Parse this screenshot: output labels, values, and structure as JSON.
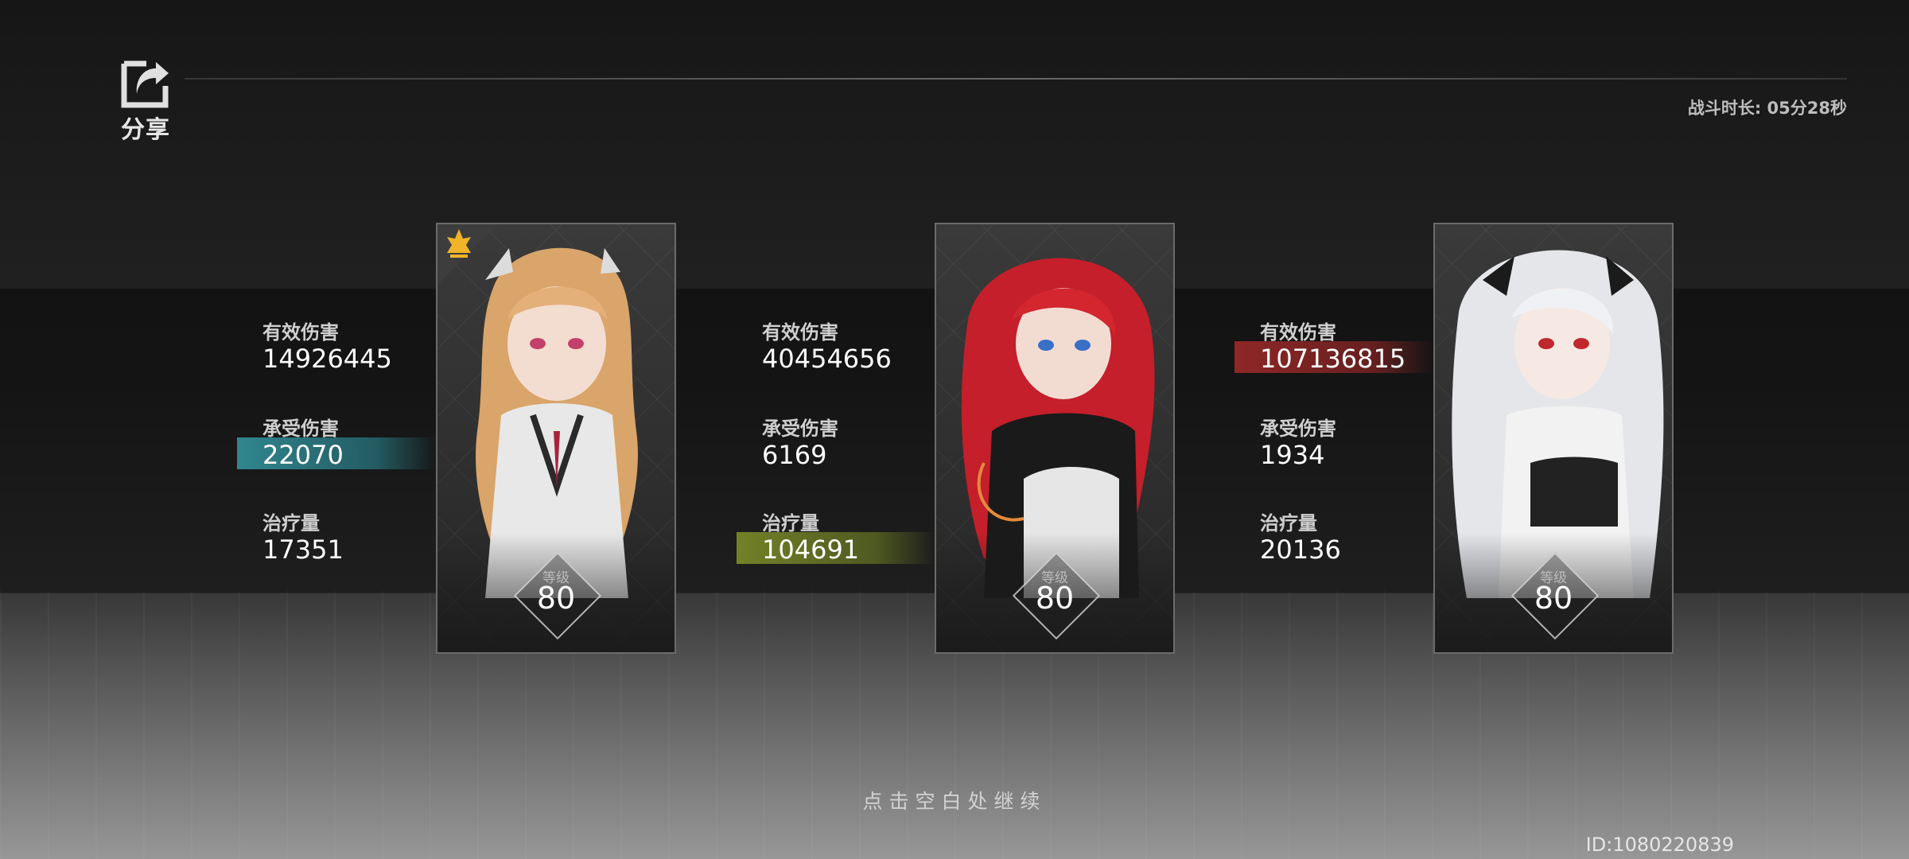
{
  "header": {
    "share_label": "分享",
    "duration_text": "战斗时长: 05分28秒"
  },
  "labels": {
    "damage": "有效伤害",
    "taken": "承受伤害",
    "heal": "治疗量",
    "level": "等级"
  },
  "characters": [
    {
      "name": "blonde-heroine",
      "damage": "14926445",
      "taken": "22070",
      "heal": "17351",
      "level": "80",
      "mvp": true,
      "highlight": "taken"
    },
    {
      "name": "red-heroine",
      "damage": "40454656",
      "taken": "6169",
      "heal": "104691",
      "level": "80",
      "mvp": false,
      "highlight": "heal"
    },
    {
      "name": "white-heroine",
      "damage": "107136815",
      "taken": "1934",
      "heal": "20136",
      "level": "80",
      "mvp": false,
      "highlight": "damage"
    }
  ],
  "colors": {
    "top_taken": "#328c96",
    "top_heal": "#78872a",
    "top_damage": "#962828",
    "mvp_badge": "#f0b428"
  },
  "footer": {
    "continue_text": "点击空白处继续",
    "player_id": "ID:1080220839"
  }
}
